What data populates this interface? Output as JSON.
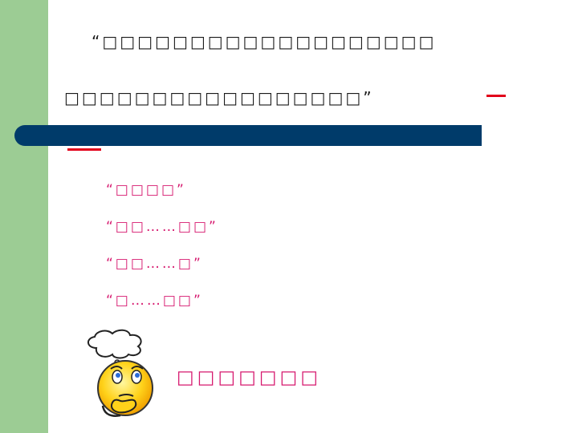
{
  "slide": {
    "title_line1": "“□□□□□□□□□□□□□□□□□□□",
    "title_line2": "□□□□□□□□□□□□□□□□□”",
    "items": [
      "“□□□□”",
      "“□□……□□”",
      "“□□……□”",
      "“□……□□”"
    ],
    "question": "□□□□□□□",
    "icons": {
      "thinker": "thinking-face-icon"
    },
    "colors": {
      "left_bar": "#9ccc94",
      "divider_bar": "#003b6a",
      "accent_red": "#e2001a",
      "list_text": "#d6186e"
    }
  }
}
